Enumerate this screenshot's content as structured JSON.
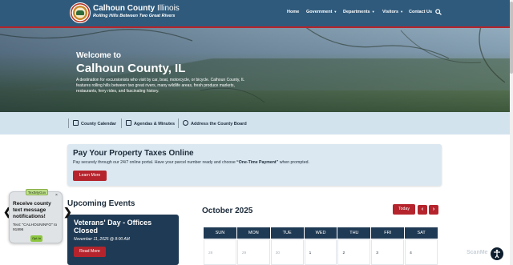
{
  "header": {
    "county": "Calhoun County",
    "state": "Illinois",
    "tagline": "Rolling Hills Between Two Great Rivers",
    "nav": [
      {
        "label": "Home"
      },
      {
        "label": "Government"
      },
      {
        "label": "Departments"
      },
      {
        "label": "Visitors"
      },
      {
        "label": "Contact Us"
      }
    ],
    "icons": {
      "seal": "county-seal",
      "search": "search-icon",
      "dropdown": "chevron-down-icon"
    }
  },
  "hero": {
    "pretitle": "Welcome to",
    "title": "Calhoun County, IL",
    "description": "A destination for excursionists who visit by car, boat, motorcycle, or bicycle. Calhoun County, IL features rolling hills between two great rivers, many wildlife areas, fresh produce markets, restaurants, ferry rides, and fascinating history."
  },
  "quick_links": [
    {
      "label": "County Calendar",
      "icon": "calendar-icon"
    },
    {
      "label": "Agendas & Minutes",
      "icon": "clipboard-icon"
    },
    {
      "label": "Address the County Board",
      "icon": "chat-icon"
    }
  ],
  "tax_banner": {
    "title": "Pay Your Property Taxes Online",
    "text_before": "Pay securely through our 24/7 online portal. Have your parcel number ready and choose ",
    "text_bold": "“One-Time Payment”",
    "text_after": " when prompted.",
    "button": "Learn More"
  },
  "events": {
    "title": "Upcoming Events",
    "card": {
      "title": "Veterans' Day - Offices Closed",
      "date": "November 11, 2025 @ 8:00 AM",
      "button": "Read More"
    }
  },
  "calendar": {
    "month": "October 2025",
    "today_button": "Today",
    "prev_icon": "‹",
    "next_icon": "›",
    "days": [
      "SUN",
      "MON",
      "TUE",
      "WED",
      "THU",
      "FRI",
      "SAT"
    ],
    "first_week": [
      {
        "day": "28",
        "current": false
      },
      {
        "day": "29",
        "current": false
      },
      {
        "day": "30",
        "current": false
      },
      {
        "day": "1",
        "current": true
      },
      {
        "day": "2",
        "current": true
      },
      {
        "day": "3",
        "current": true
      },
      {
        "day": "4",
        "current": true
      }
    ]
  },
  "text_alert": {
    "badge": "TextMyGov",
    "close": "×",
    "title": "Receive county text message notifications!",
    "text": "Text: \"CALHOUNINFO\" to 91896",
    "button": "Opt-In",
    "prev": "❮",
    "next": "❯"
  },
  "footer_widgets": {
    "scanme": "ScanMe",
    "accessibility_icon": "accessibility-icon"
  },
  "colors": {
    "header_bg": "#2f5a7c",
    "accent_red": "#b5242c",
    "navy": "#1f3a54",
    "light_blue": "#d3e3ee",
    "banner_bg": "#dbe8f1"
  }
}
